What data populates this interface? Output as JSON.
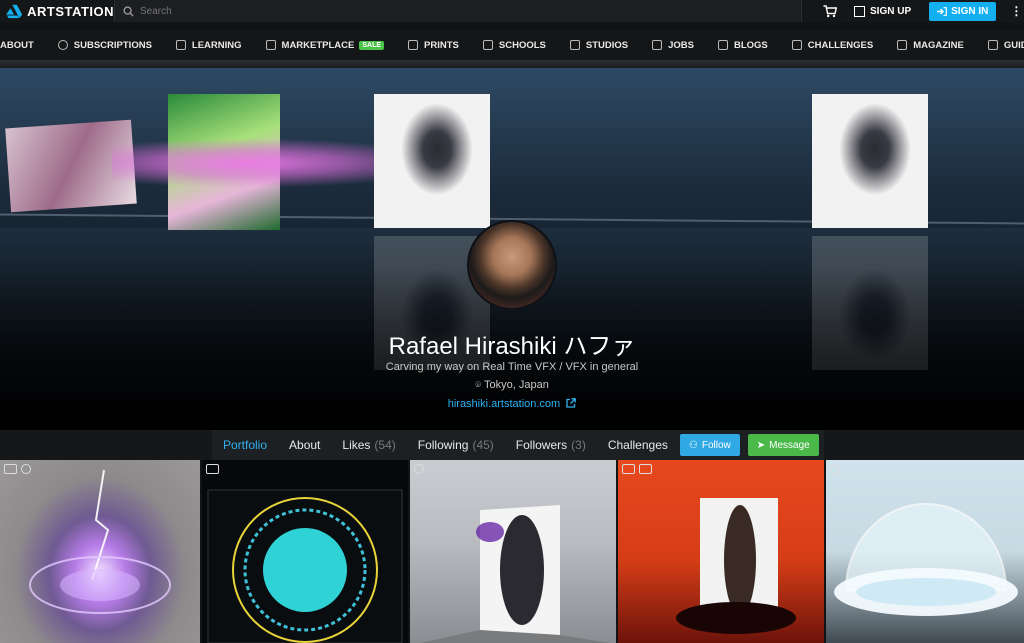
{
  "brand": {
    "name": "ARTSTATION",
    "accent": "#13aff0"
  },
  "search": {
    "placeholder": "Search"
  },
  "header": {
    "signup_label": "SIGN UP",
    "signin_label": "SIGN IN"
  },
  "nav": {
    "items": [
      {
        "label": "ABOUT",
        "icon": "question-circle-icon"
      },
      {
        "label": "SUBSCRIPTIONS",
        "icon": "circle-plus-icon"
      },
      {
        "label": "LEARNING",
        "icon": "graduation-cap-icon"
      },
      {
        "label": "MARKETPLACE",
        "icon": "cube-icon",
        "badge": "SALE"
      },
      {
        "label": "PRINTS",
        "icon": "print-icon"
      },
      {
        "label": "SCHOOLS",
        "icon": "school-icon"
      },
      {
        "label": "STUDIOS",
        "icon": "studio-icon"
      },
      {
        "label": "JOBS",
        "icon": "briefcase-icon"
      },
      {
        "label": "BLOGS",
        "icon": "document-icon"
      },
      {
        "label": "CHALLENGES",
        "icon": "trophy-icon"
      },
      {
        "label": "MAGAZINE",
        "icon": "magazine-icon"
      },
      {
        "label": "GUIDES",
        "icon": "book-icon"
      }
    ]
  },
  "profile": {
    "name": "Rafael Hirashiki ハファ",
    "bio": "Carving my way on Real Time VFX / VFX in general",
    "location": "Tokyo, Japan",
    "website": "hirashiki.artstation.com"
  },
  "tabs": {
    "portfolio": "Portfolio",
    "about": "About",
    "likes": {
      "label": "Likes",
      "count": "(54)"
    },
    "following": {
      "label": "Following",
      "count": "(45)"
    },
    "followers": {
      "label": "Followers",
      "count": "(3)"
    },
    "challenges": "Challenges",
    "follow_label": "Follow",
    "message_label": "Message"
  },
  "thumbnails": [
    {
      "icons": [
        "image-icon",
        "rotate-icon"
      ]
    },
    {
      "icons": [
        "video-icon"
      ]
    },
    {
      "icons": [
        "rotate-icon"
      ]
    },
    {
      "icons": [
        "image-icon",
        "video-icon"
      ]
    },
    {
      "icons": [
        "rotate-icon"
      ]
    }
  ]
}
